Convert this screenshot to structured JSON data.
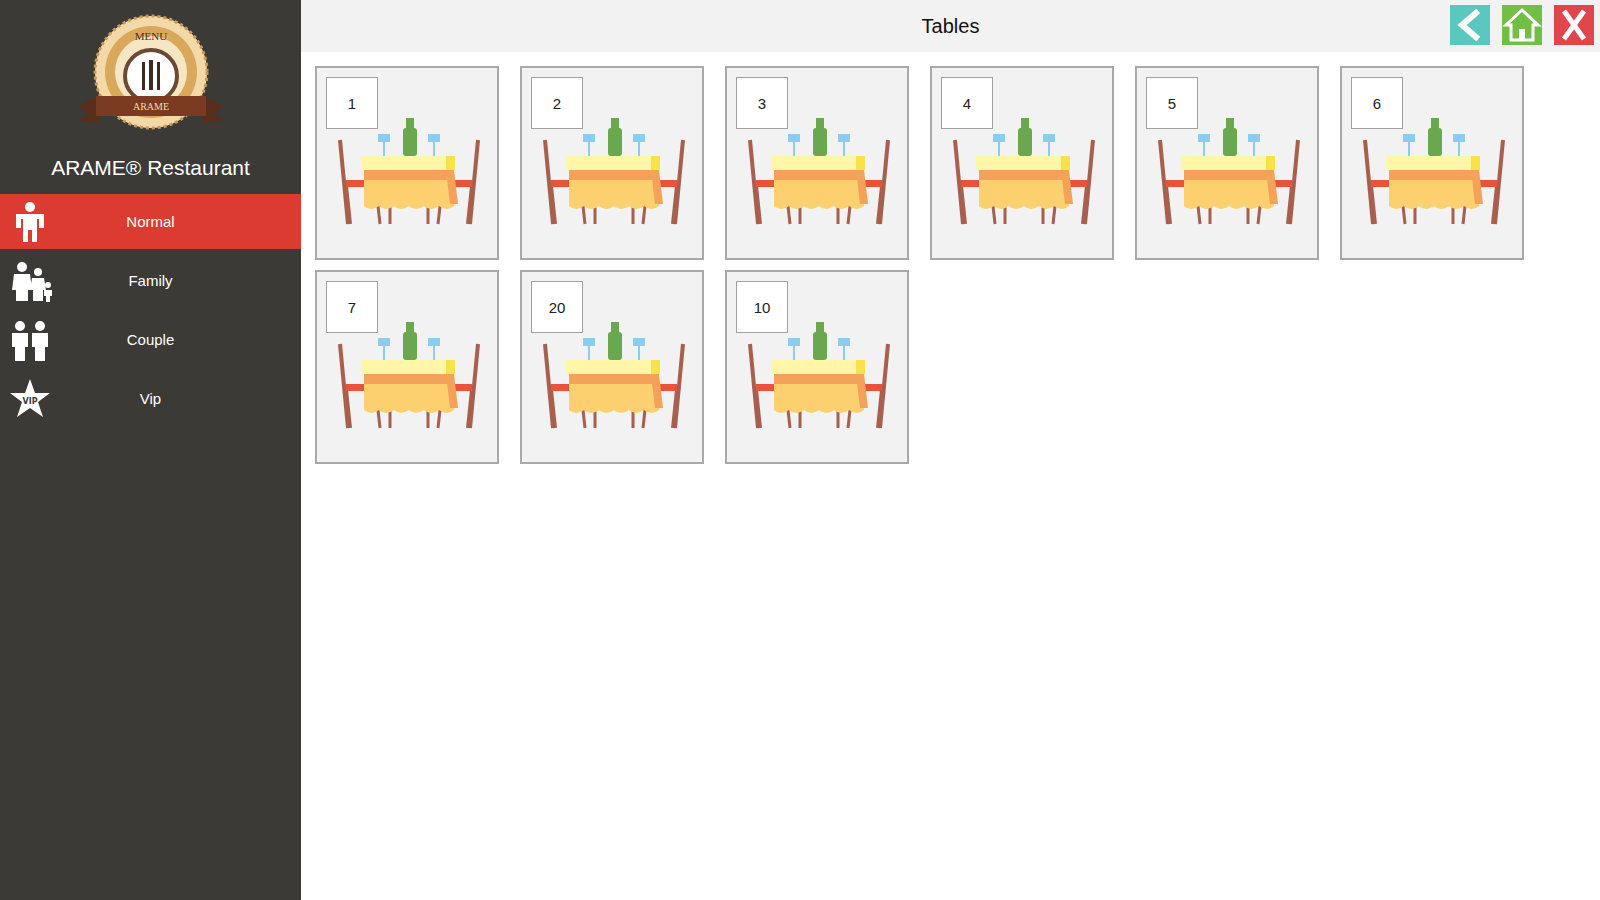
{
  "window": {
    "title": "Tables"
  },
  "logo": {
    "top_text": "MENU",
    "ribbon_text": "ARAME"
  },
  "app_name": "ARAME® Restaurant",
  "sidebar": {
    "items": [
      {
        "label": "Normal",
        "selected": true,
        "kind": "person"
      },
      {
        "label": "Family",
        "selected": false,
        "kind": "family"
      },
      {
        "label": "Couple",
        "selected": false,
        "kind": "couple"
      },
      {
        "label": "Vip",
        "selected": false,
        "kind": "vip"
      }
    ],
    "vip_star_text": "VIP"
  },
  "tables": [
    "1",
    "2",
    "3",
    "4",
    "5",
    "6",
    "7",
    "20",
    "10"
  ]
}
